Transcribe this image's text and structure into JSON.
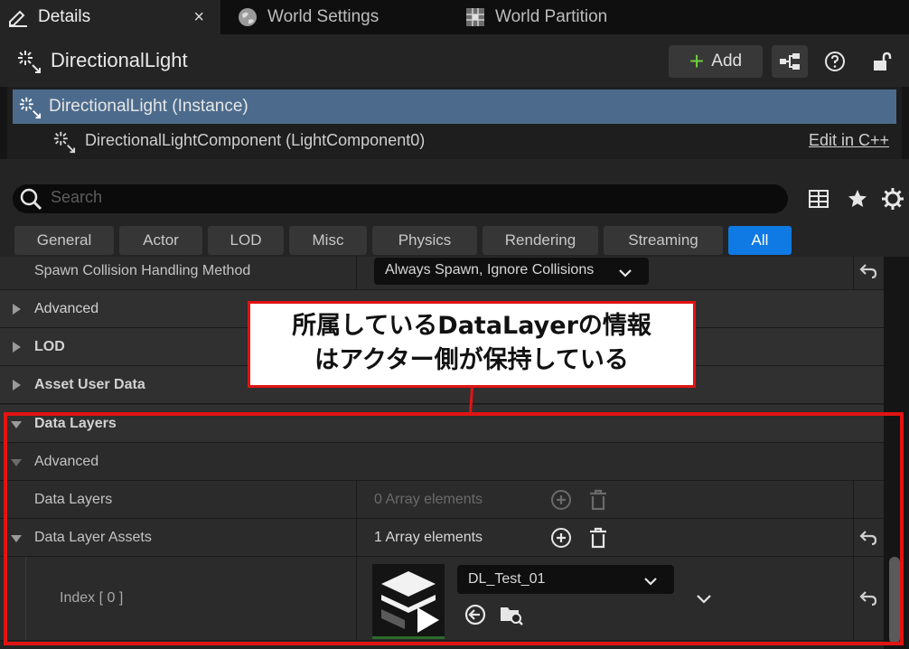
{
  "tabs": [
    {
      "label": "Details",
      "icon": "pencil-icon",
      "active": true
    },
    {
      "label": "World Settings",
      "icon": "globe-icon"
    },
    {
      "label": "World Partition",
      "icon": "grid-map-icon"
    }
  ],
  "tab_close": "×",
  "header": {
    "title": "DirectionalLight",
    "add_label": "Add"
  },
  "components": {
    "instance": "DirectionalLight (Instance)",
    "child": "DirectionalLightComponent (LightComponent0)",
    "edit_link": "Edit in C++"
  },
  "search": {
    "placeholder": "Search"
  },
  "filters": [
    "General",
    "Actor",
    "LOD",
    "Misc",
    "Physics",
    "Rendering",
    "Streaming",
    "All"
  ],
  "active_filter": "All",
  "properties": {
    "spawn_label": "Spawn Collision Handling Method",
    "spawn_value": "Always Spawn, Ignore Collisions",
    "advanced": "Advanced",
    "lod": "LOD",
    "asset_user_data": "Asset User Data",
    "data_layers_cat": "Data Layers",
    "advanced_sub": "Advanced",
    "data_layers": "Data Layers",
    "data_layers_value": "0 Array elements",
    "data_layer_assets": "Data Layer Assets",
    "data_layer_assets_value": "1 Array elements",
    "index_label": "Index [ 0 ]",
    "asset_value": "DL_Test_01"
  },
  "annotation": {
    "line1": "所属しているDataLayerの情報",
    "line2": "はアクター側が保持している"
  },
  "colors": {
    "selection": "#4c6b8c",
    "active_chip": "#0f79e4",
    "add_plus": "#6fcf3f",
    "annotation_red": "#e11414"
  }
}
